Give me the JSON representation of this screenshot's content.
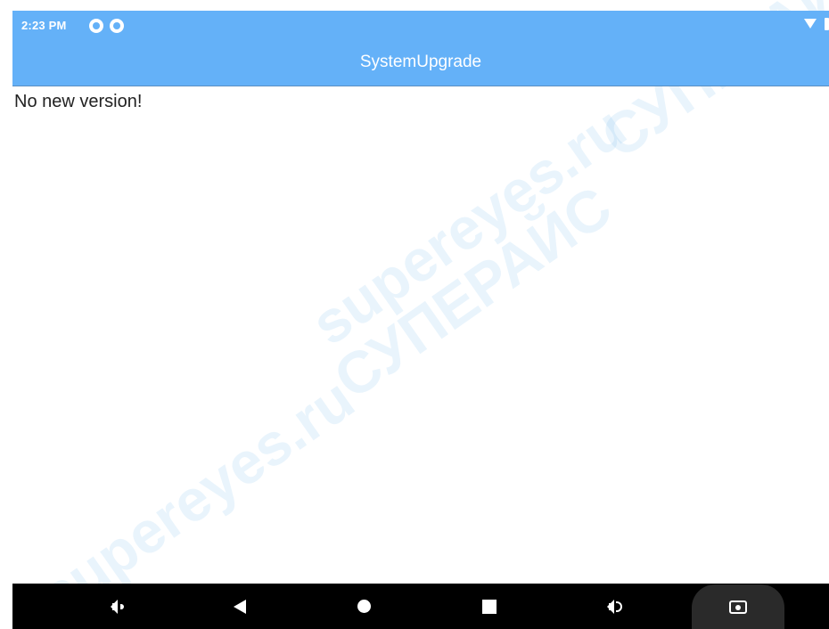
{
  "status_bar": {
    "time": "2:23 PM",
    "icons": [
      "app-notification-icon",
      "app-notification-icon",
      "wifi-icon",
      "battery-icon"
    ]
  },
  "app_bar": {
    "title": "SystemUpgrade",
    "background_color": "#64b1f8"
  },
  "content": {
    "message": "No new version!"
  },
  "watermark": {
    "text_latin": "supereyes.ru",
    "text_cyrillic": "СУПЕРАЙС"
  },
  "nav_bar": {
    "buttons": [
      "volume-down-icon",
      "back-icon",
      "home-icon",
      "recents-icon",
      "volume-up-icon",
      "camera-icon"
    ]
  }
}
